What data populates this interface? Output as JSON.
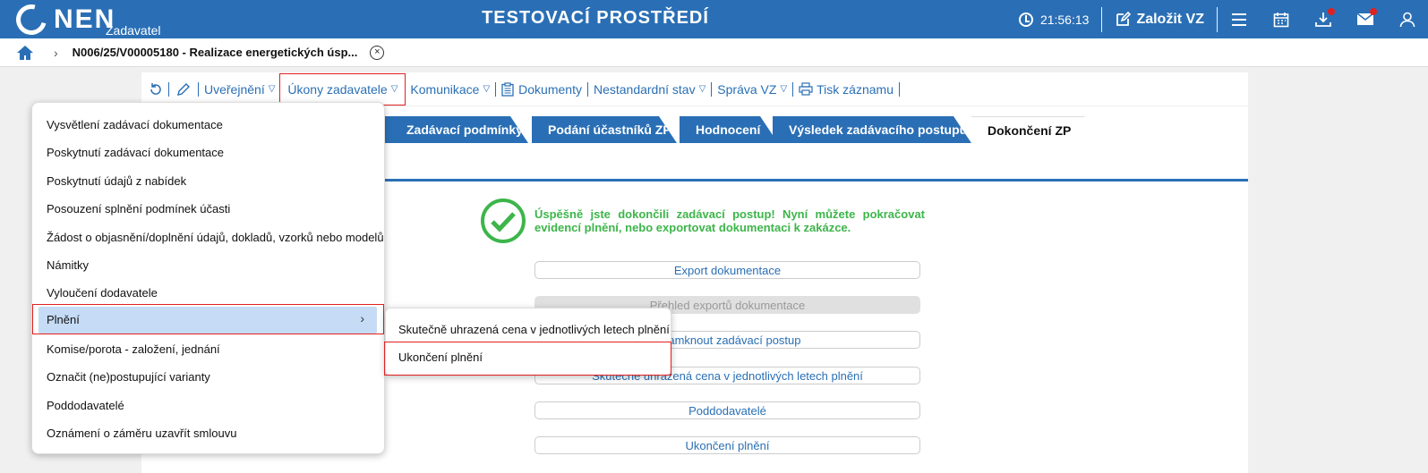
{
  "topbar": {
    "logo_text": "NEN",
    "logo_sub": "Zadavatel",
    "env_title": "TESTOVACÍ PROSTŘEDÍ",
    "time": "21:56:13",
    "create_label": "Založit VZ",
    "icons": [
      "menu-icon",
      "calendar-icon",
      "download-icon",
      "mail-icon",
      "user-icon"
    ]
  },
  "breadcrumb": {
    "current": "N006/25/V00005180 - Realizace energetických úsp..."
  },
  "toolbar": {
    "items": [
      "Uveřejnění",
      "Úkony zadavatele",
      "Komunikace",
      "Dokumenty",
      "Nestandardní stav",
      "Správa VZ",
      "Tisk záznamu"
    ]
  },
  "tabs": [
    "Zadávací podmínky",
    "Podání účastníků ZP",
    "Hodnocení",
    "Výsledek zadávacího postupu",
    "Dokončení ZP"
  ],
  "main": {
    "success_message": "Úspěšně jste dokončili zadávací postup! Nyní můžete pokračovat evidencí plnění, nebo exportovat dokumentaci k zakázce.",
    "buttons": [
      "Export dokumentace",
      "Přehled exportů dokumentace",
      "Uzamknout zadávací postup",
      "Skutečně uhrazená cena v jednotlivých letech plnění",
      "Poddodavatelé",
      "Ukončení plnění"
    ]
  },
  "menu": {
    "items": [
      "Vysvětlení zadávací dokumentace",
      "Poskytnutí zadávací dokumentace",
      "Poskytnutí údajů z nabídek",
      "Posouzení splnění podmínek účasti",
      "Žádost o objasnění/doplnění údajů, dokladů, vzorků nebo modelů",
      "Námitky",
      "Vyloučení dodavatele",
      "Plnění",
      "Komise/porota - založení, jednání",
      "Označit (ne)postupující varianty",
      "Poddodavatelé",
      "Oznámení o záměru uzavřít smlouvu"
    ]
  },
  "submenu": {
    "items": [
      "Skutečně uhrazená cena v jednotlivých letech plnění",
      "Ukončení plnění"
    ]
  },
  "colors": {
    "brand": "#2a6fb5",
    "success": "#3db54a",
    "highlight": "#e02020",
    "menu_active": "#c6dcf6"
  }
}
